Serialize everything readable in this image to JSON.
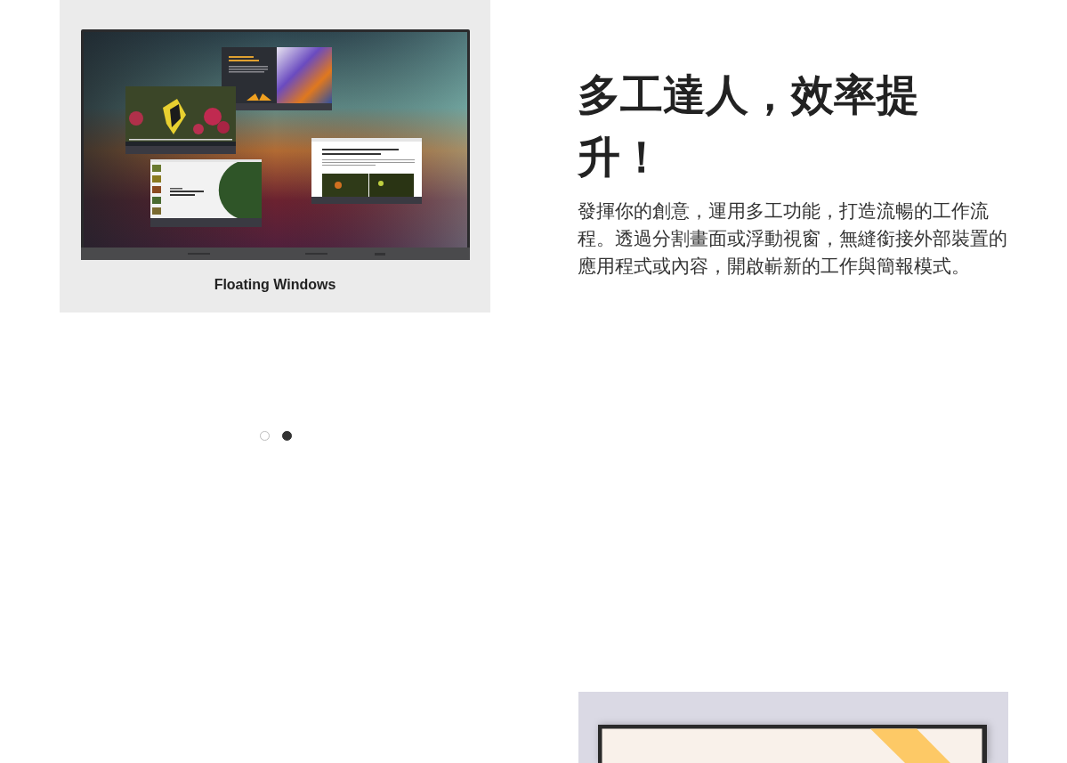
{
  "feature_gallery": {
    "image_caption": "Floating Windows",
    "dots": [
      {
        "selected": false
      },
      {
        "selected": true
      }
    ]
  },
  "feature_text": {
    "heading": "多工達人，效率提升！",
    "body": "發揮你的創意，運用多工功能，打造流暢的工作流程。透過分割畫面或浮動視窗，無縫銜接外部裝置的應用程式或內容，開啟嶄新的工作與簡報模式。"
  }
}
